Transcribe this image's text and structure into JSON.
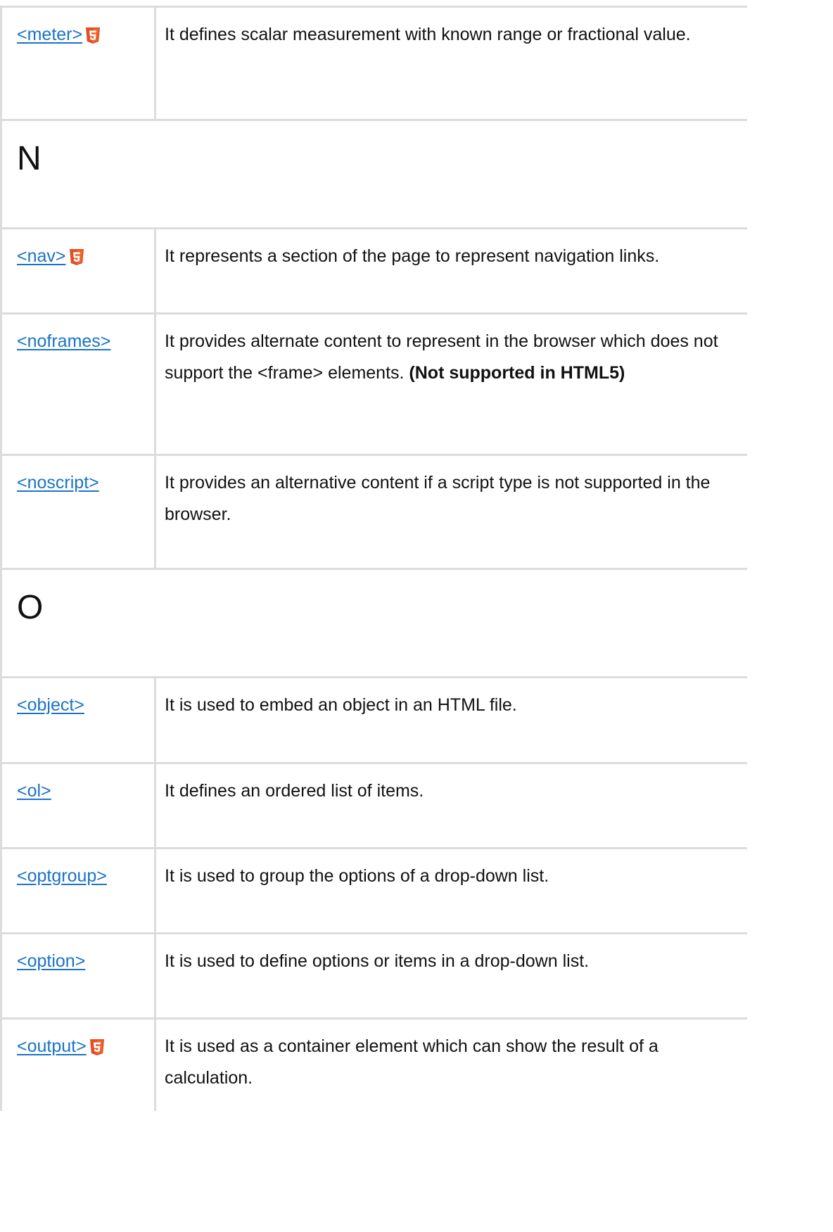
{
  "rows": [
    {
      "kind": "tag",
      "tag": "<meter>",
      "html5": true,
      "desc": "It defines scalar measurement with known range or fractional value.",
      "bold": ""
    },
    {
      "kind": "section",
      "letter": "N"
    },
    {
      "kind": "tag",
      "tag": "<nav>",
      "html5": true,
      "desc": "It represents a section of the page to represent navigation links.",
      "bold": ""
    },
    {
      "kind": "tag",
      "tag": "<noframes>",
      "html5": false,
      "desc": "It provides alternate content to represent in the browser which does not support the <frame> elements. ",
      "bold": "(Not supported in HTML5)"
    },
    {
      "kind": "tag",
      "tag": "<noscript>",
      "html5": false,
      "desc": "It provides an alternative content if a script type is not supported in the browser.",
      "bold": ""
    },
    {
      "kind": "section",
      "letter": "O"
    },
    {
      "kind": "tag",
      "tag": "<object>",
      "html5": false,
      "desc": "It is used to embed an object in an HTML file.",
      "bold": ""
    },
    {
      "kind": "tag",
      "tag": "<ol>",
      "html5": false,
      "desc": "It defines an ordered list of items.",
      "bold": ""
    },
    {
      "kind": "tag",
      "tag": "<optgroup>",
      "html5": false,
      "desc": "It is used to group the options of a drop-down list.",
      "bold": ""
    },
    {
      "kind": "tag",
      "tag": "<option>",
      "html5": false,
      "desc": "It is used to define options or items in a drop-down list.",
      "bold": ""
    },
    {
      "kind": "tag",
      "tag": "<output>",
      "html5": true,
      "desc": "It is used as a container element which can show the result of a calculation.",
      "bold": ""
    }
  ],
  "colors": {
    "link": "#1a73c8",
    "border": "#dcdcdc",
    "html5_badge": "#e44d26"
  },
  "icons": {
    "html5": "html5-icon"
  }
}
